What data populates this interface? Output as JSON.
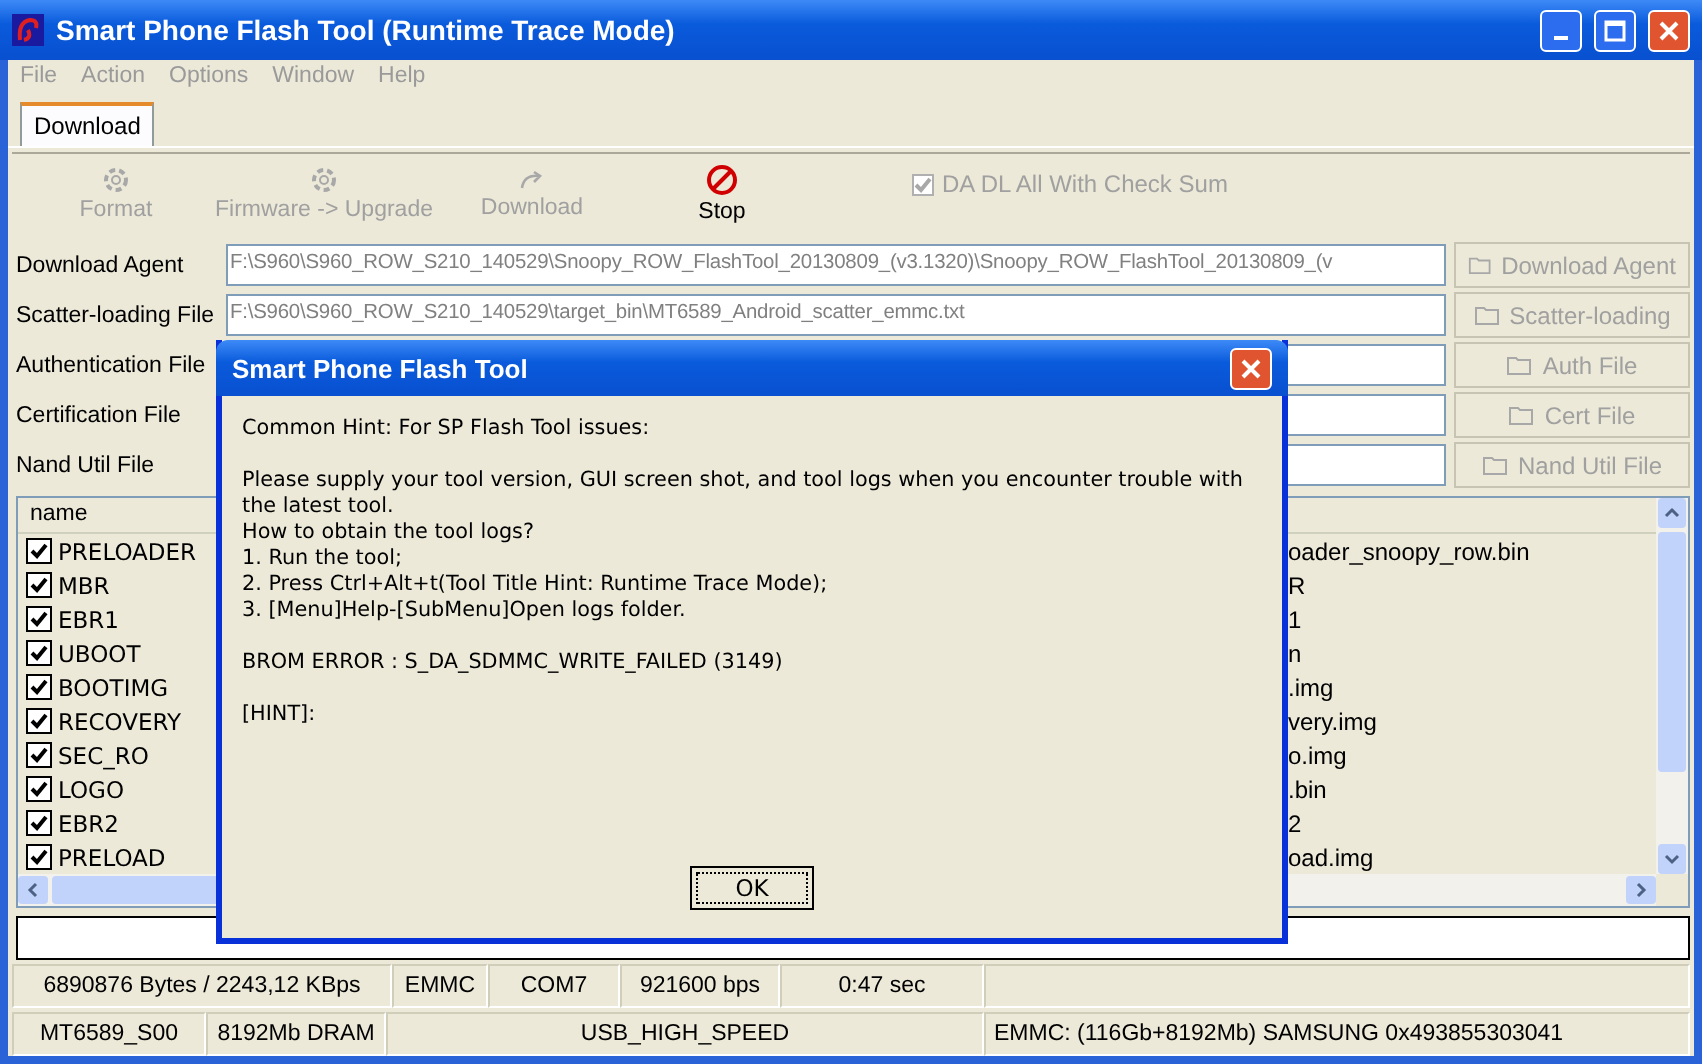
{
  "window": {
    "title": "Smart Phone Flash Tool (Runtime Trace Mode)"
  },
  "menu": [
    "File",
    "Action",
    "Options",
    "Window",
    "Help"
  ],
  "tabs": [
    {
      "label": "Download",
      "selected": true
    }
  ],
  "toolbar": {
    "buttons": [
      {
        "label": "Format",
        "kind": "gear",
        "disabled": true
      },
      {
        "label": "Firmware -> Upgrade",
        "kind": "gear",
        "disabled": true
      },
      {
        "label": "Download",
        "kind": "redo",
        "disabled": true
      },
      {
        "label": "Stop",
        "kind": "stop",
        "disabled": false
      }
    ],
    "checkbox": {
      "label": "DA DL All With Check Sum",
      "checked": true,
      "disabled": true
    }
  },
  "files": [
    {
      "label": "Download Agent",
      "value": "F:\\S960\\S960_ROW_S210_140529\\Snoopy_ROW_FlashTool_20130809_(v3.1320)\\Snoopy_ROW_FlashTool_20130809_(v",
      "button": "Download Agent",
      "disabled": true
    },
    {
      "label": "Scatter-loading File",
      "value": "F:\\S960\\S960_ROW_S210_140529\\target_bin\\MT6589_Android_scatter_emmc.txt",
      "button": "Scatter-loading",
      "disabled": true
    },
    {
      "label": "Authentication File",
      "button": "Auth File",
      "disabled": true
    },
    {
      "label": "Certification File",
      "button": "Cert File",
      "disabled": true
    },
    {
      "label": "Nand Util File",
      "button": "Nand Util File",
      "disabled": true
    }
  ],
  "list": {
    "columns": [
      "name"
    ],
    "rows": [
      {
        "name": "PRELOADER",
        "checked": true,
        "file": "oader_snoopy_row.bin"
      },
      {
        "name": "MBR",
        "checked": true,
        "file": "R"
      },
      {
        "name": "EBR1",
        "checked": true,
        "file": "1"
      },
      {
        "name": "UBOOT",
        "checked": true,
        "file": "n"
      },
      {
        "name": "BOOTIMG",
        "checked": true,
        "file": ".img"
      },
      {
        "name": "RECOVERY",
        "checked": true,
        "file": "very.img"
      },
      {
        "name": "SEC_RO",
        "checked": true,
        "file": "o.img"
      },
      {
        "name": "LOGO",
        "checked": true,
        "file": ".bin"
      },
      {
        "name": "EBR2",
        "checked": true,
        "file": "2"
      },
      {
        "name": "PRELOAD",
        "checked": true,
        "file": "oad.img"
      }
    ]
  },
  "status_bar": [
    [
      "6890876 Bytes / 2243,12 KBps",
      "EMMC",
      "COM7",
      "921600 bps",
      "0:47 sec"
    ],
    [
      "MT6589_S00",
      "8192Mb DRAM",
      "USB_HIGH_SPEED",
      "EMMC: (116Gb+8192Mb) SAMSUNG 0x493855303041"
    ]
  ],
  "dialog": {
    "title": "Smart Phone Flash Tool",
    "paragraphs": [
      [
        "Common Hint: For SP Flash Tool issues:"
      ],
      [
        "Please supply your tool version, GUI screen shot, and tool logs when you encounter trouble with the latest tool.",
        "How to obtain the tool logs?",
        "1. Run the tool;",
        "2. Press Ctrl+Alt+t(Tool Title Hint: Runtime Trace Mode);",
        "3. [Menu]Help-[SubMenu]Open logs folder."
      ],
      [
        "BROM ERROR : S_DA_SDMMC_WRITE_FAILED (3149)"
      ],
      [
        "[HINT]:"
      ]
    ],
    "button": "OK"
  }
}
